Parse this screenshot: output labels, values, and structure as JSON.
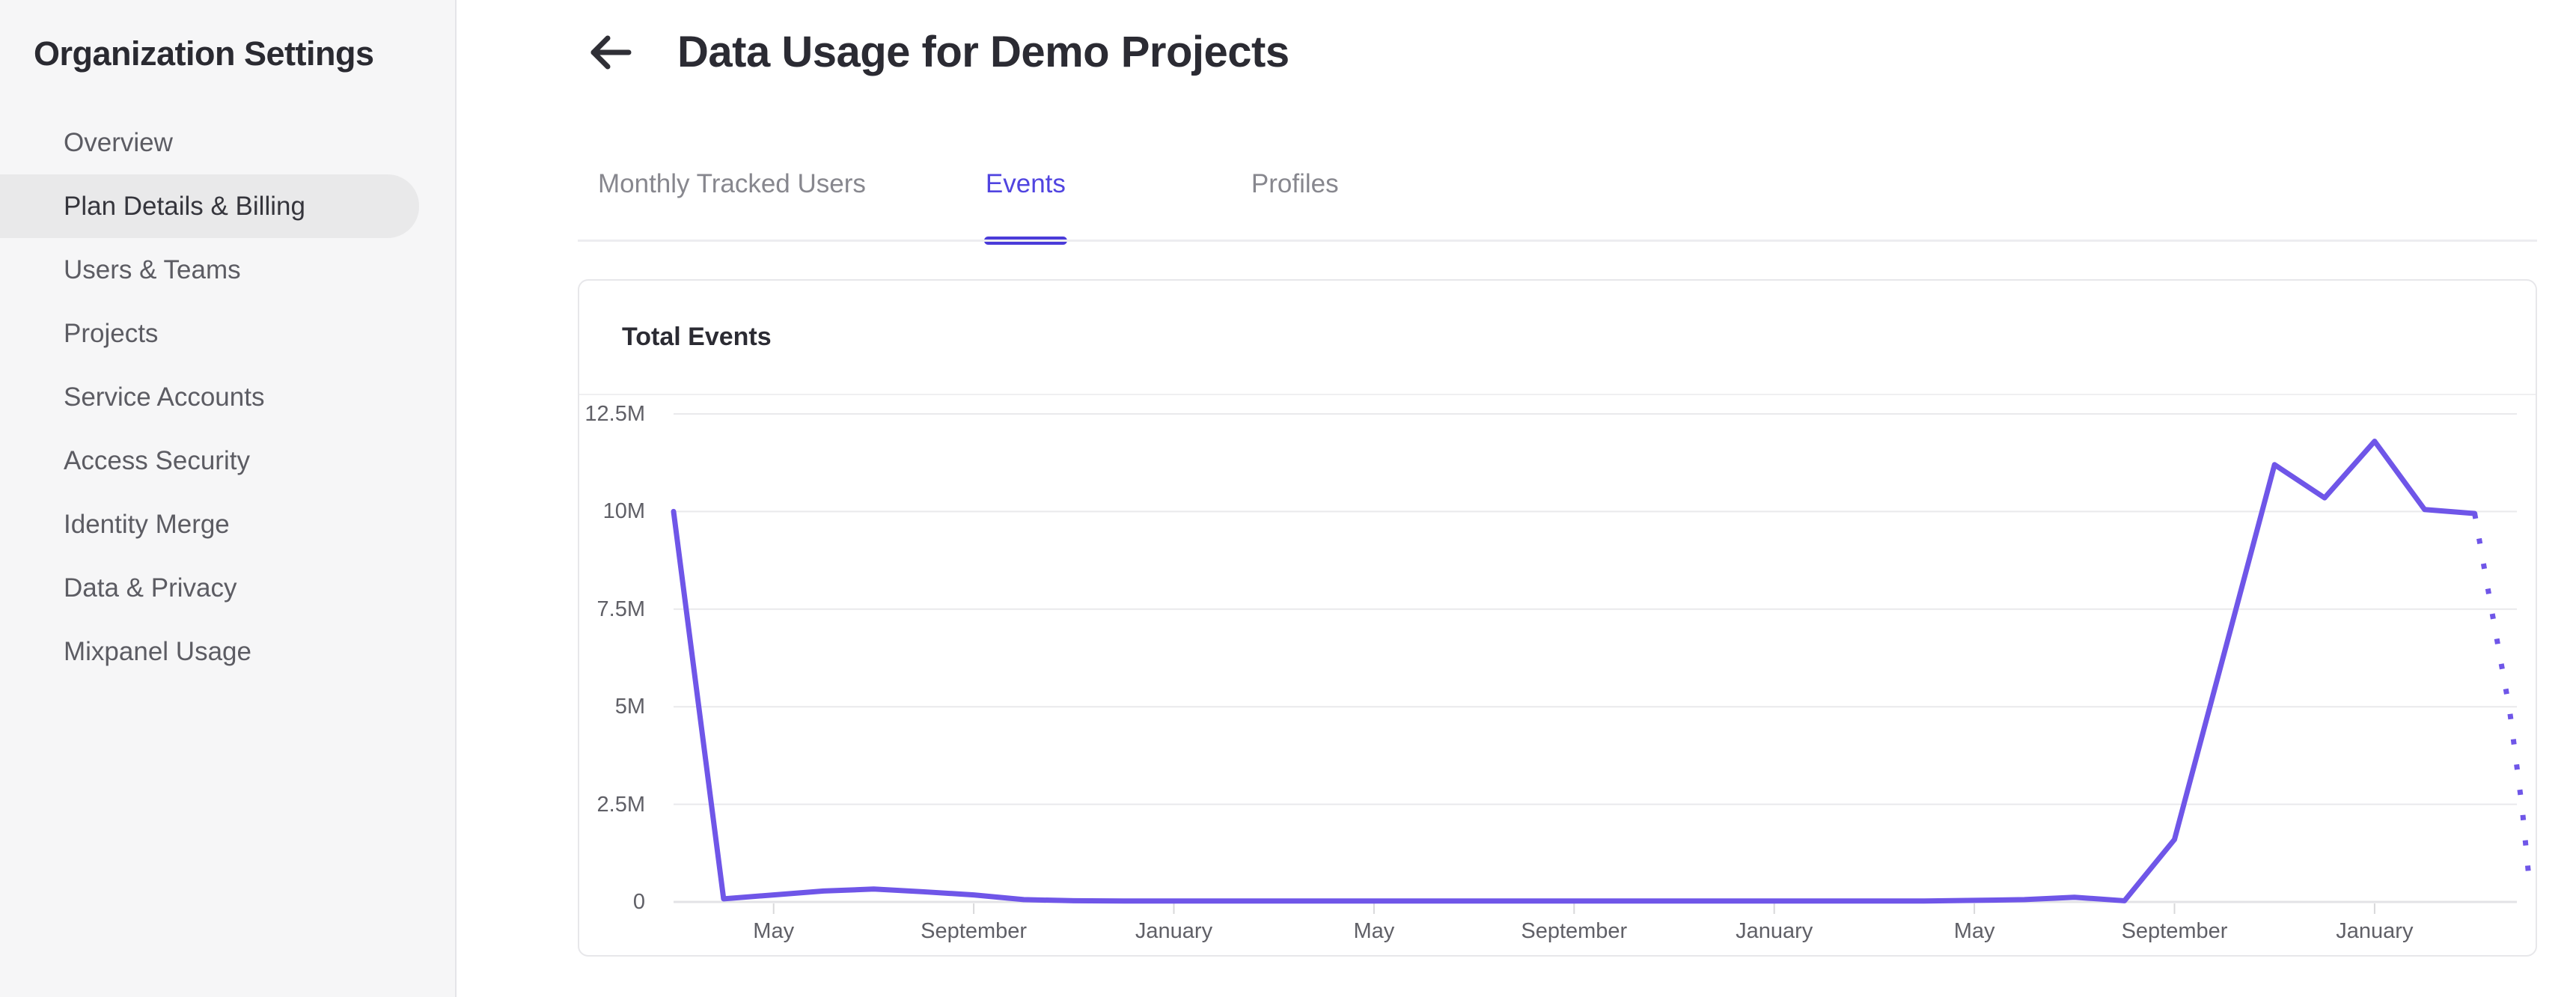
{
  "sidebar": {
    "title": "Organization Settings",
    "items": [
      {
        "label": "Overview",
        "selected": false
      },
      {
        "label": "Plan Details & Billing",
        "selected": true
      },
      {
        "label": "Users & Teams",
        "selected": false
      },
      {
        "label": "Projects",
        "selected": false
      },
      {
        "label": "Service Accounts",
        "selected": false
      },
      {
        "label": "Access Security",
        "selected": false
      },
      {
        "label": "Identity Merge",
        "selected": false
      },
      {
        "label": "Data & Privacy",
        "selected": false
      },
      {
        "label": "Mixpanel Usage",
        "selected": false
      }
    ]
  },
  "header": {
    "title": "Data Usage for Demo Projects",
    "back_icon": "arrow-left-icon"
  },
  "tabs": [
    {
      "label": "Monthly Tracked Users",
      "active": false
    },
    {
      "label": "Events",
      "active": true
    },
    {
      "label": "Profiles",
      "active": false
    }
  ],
  "card": {
    "title": "Total Events"
  },
  "colors": {
    "accent_purple": "#5044e0",
    "tab_indicator": "#4a3bd9",
    "chart_line": "#6f56e8",
    "sidebar_bg": "#f6f6f7",
    "selected_pill": "#e9e9ea",
    "gridline": "#e9e9ec",
    "baseline": "#e3e3e6",
    "axis_text": "#5f5f66"
  },
  "chart_data": {
    "type": "line",
    "title": "Total Events",
    "ylim": [
      0,
      12500000
    ],
    "grid": "horizontal",
    "legend": "none",
    "y_ticks": [
      {
        "label": "12.5M",
        "value": 12500000
      },
      {
        "label": "10M",
        "value": 10000000
      },
      {
        "label": "7.5M",
        "value": 7500000
      },
      {
        "label": "5M",
        "value": 5000000
      },
      {
        "label": "2.5M",
        "value": 2500000
      },
      {
        "label": "0",
        "value": 0
      }
    ],
    "x_ticks": [
      {
        "label": "May",
        "month_index": 2
      },
      {
        "label": "September",
        "month_index": 6
      },
      {
        "label": "January",
        "month_index": 10
      },
      {
        "label": "May",
        "month_index": 14
      },
      {
        "label": "September",
        "month_index": 18
      },
      {
        "label": "January",
        "month_index": 22
      },
      {
        "label": "May",
        "month_index": 26
      },
      {
        "label": "September",
        "month_index": 30
      },
      {
        "label": "January",
        "month_index": 34
      }
    ],
    "series": [
      {
        "name": "Total Events",
        "color": "#6f56e8",
        "style": "solid",
        "points": [
          {
            "month_index": 0,
            "value": 10000000
          },
          {
            "month_index": 1,
            "value": 80000
          },
          {
            "month_index": 2,
            "value": 180000
          },
          {
            "month_index": 3,
            "value": 280000
          },
          {
            "month_index": 4,
            "value": 330000
          },
          {
            "month_index": 5,
            "value": 260000
          },
          {
            "month_index": 6,
            "value": 180000
          },
          {
            "month_index": 7,
            "value": 60000
          },
          {
            "month_index": 8,
            "value": 30000
          },
          {
            "month_index": 9,
            "value": 25000
          },
          {
            "month_index": 10,
            "value": 25000
          },
          {
            "month_index": 11,
            "value": 25000
          },
          {
            "month_index": 12,
            "value": 25000
          },
          {
            "month_index": 13,
            "value": 25000
          },
          {
            "month_index": 14,
            "value": 25000
          },
          {
            "month_index": 15,
            "value": 25000
          },
          {
            "month_index": 16,
            "value": 25000
          },
          {
            "month_index": 17,
            "value": 25000
          },
          {
            "month_index": 18,
            "value": 25000
          },
          {
            "month_index": 19,
            "value": 25000
          },
          {
            "month_index": 20,
            "value": 25000
          },
          {
            "month_index": 21,
            "value": 25000
          },
          {
            "month_index": 22,
            "value": 25000
          },
          {
            "month_index": 23,
            "value": 25000
          },
          {
            "month_index": 24,
            "value": 25000
          },
          {
            "month_index": 25,
            "value": 25000
          },
          {
            "month_index": 26,
            "value": 40000
          },
          {
            "month_index": 27,
            "value": 60000
          },
          {
            "month_index": 28,
            "value": 120000
          },
          {
            "month_index": 29,
            "value": 30000
          },
          {
            "month_index": 30,
            "value": 1600000
          },
          {
            "month_index": 31,
            "value": 6400000
          },
          {
            "month_index": 32,
            "value": 11200000
          },
          {
            "month_index": 33,
            "value": 10350000
          },
          {
            "month_index": 34,
            "value": 11800000
          },
          {
            "month_index": 35,
            "value": 10050000
          },
          {
            "month_index": 36,
            "value": 9950000
          }
        ]
      }
    ],
    "projection": {
      "style": "dotted",
      "color": "#6f56e8",
      "points": [
        {
          "month_index": 36,
          "value": 9950000
        },
        {
          "month_index": 36.35,
          "value": 7400000
        },
        {
          "month_index": 36.7,
          "value": 4900000
        },
        {
          "month_index": 36.95,
          "value": 2400000
        },
        {
          "month_index": 37.1,
          "value": 400000
        }
      ]
    }
  }
}
